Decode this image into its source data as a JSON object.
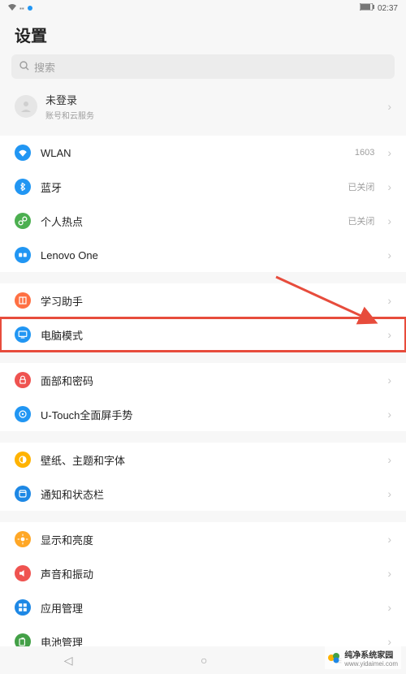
{
  "statusbar": {
    "time": "02:37",
    "carrier": ""
  },
  "title": "设置",
  "search": {
    "placeholder": "搜索"
  },
  "account": {
    "name": "未登录",
    "sub": "账号和云服务"
  },
  "groups": [
    [
      {
        "id": "wlan",
        "label": "WLAN",
        "value": "1603",
        "color": "#2196f3",
        "glyph": "wifi"
      },
      {
        "id": "bluetooth",
        "label": "蓝牙",
        "value": "已关闭",
        "color": "#2196f3",
        "glyph": "bt"
      },
      {
        "id": "hotspot",
        "label": "个人热点",
        "value": "已关闭",
        "color": "#4caf50",
        "glyph": "link"
      },
      {
        "id": "lenovoone",
        "label": "Lenovo One",
        "value": "",
        "color": "#2196f3",
        "glyph": "one"
      }
    ],
    [
      {
        "id": "study",
        "label": "学习助手",
        "value": "",
        "color": "#ff7043",
        "glyph": "book"
      },
      {
        "id": "pcmode",
        "label": "电脑模式",
        "value": "",
        "color": "#2196f3",
        "glyph": "monitor",
        "highlight": true
      }
    ],
    [
      {
        "id": "facepwd",
        "label": "面部和密码",
        "value": "",
        "color": "#ef5350",
        "glyph": "lock"
      },
      {
        "id": "utouch",
        "label": "U-Touch全面屏手势",
        "value": "",
        "color": "#2196f3",
        "glyph": "gesture"
      }
    ],
    [
      {
        "id": "theme",
        "label": "壁纸、主题和字体",
        "value": "",
        "color": "#ffb300",
        "glyph": "theme"
      },
      {
        "id": "notify",
        "label": "通知和状态栏",
        "value": "",
        "color": "#1e88e5",
        "glyph": "bell"
      }
    ],
    [
      {
        "id": "display",
        "label": "显示和亮度",
        "value": "",
        "color": "#ffa726",
        "glyph": "sun"
      },
      {
        "id": "sound",
        "label": "声音和振动",
        "value": "",
        "color": "#ef5350",
        "glyph": "sound"
      },
      {
        "id": "apps",
        "label": "应用管理",
        "value": "",
        "color": "#1e88e5",
        "glyph": "apps"
      },
      {
        "id": "battery",
        "label": "电池管理",
        "value": "",
        "color": "#43a047",
        "glyph": "battery"
      }
    ]
  ],
  "watermark": {
    "line1": "纯净系统家园",
    "line2": "www.yidaimei.com"
  }
}
